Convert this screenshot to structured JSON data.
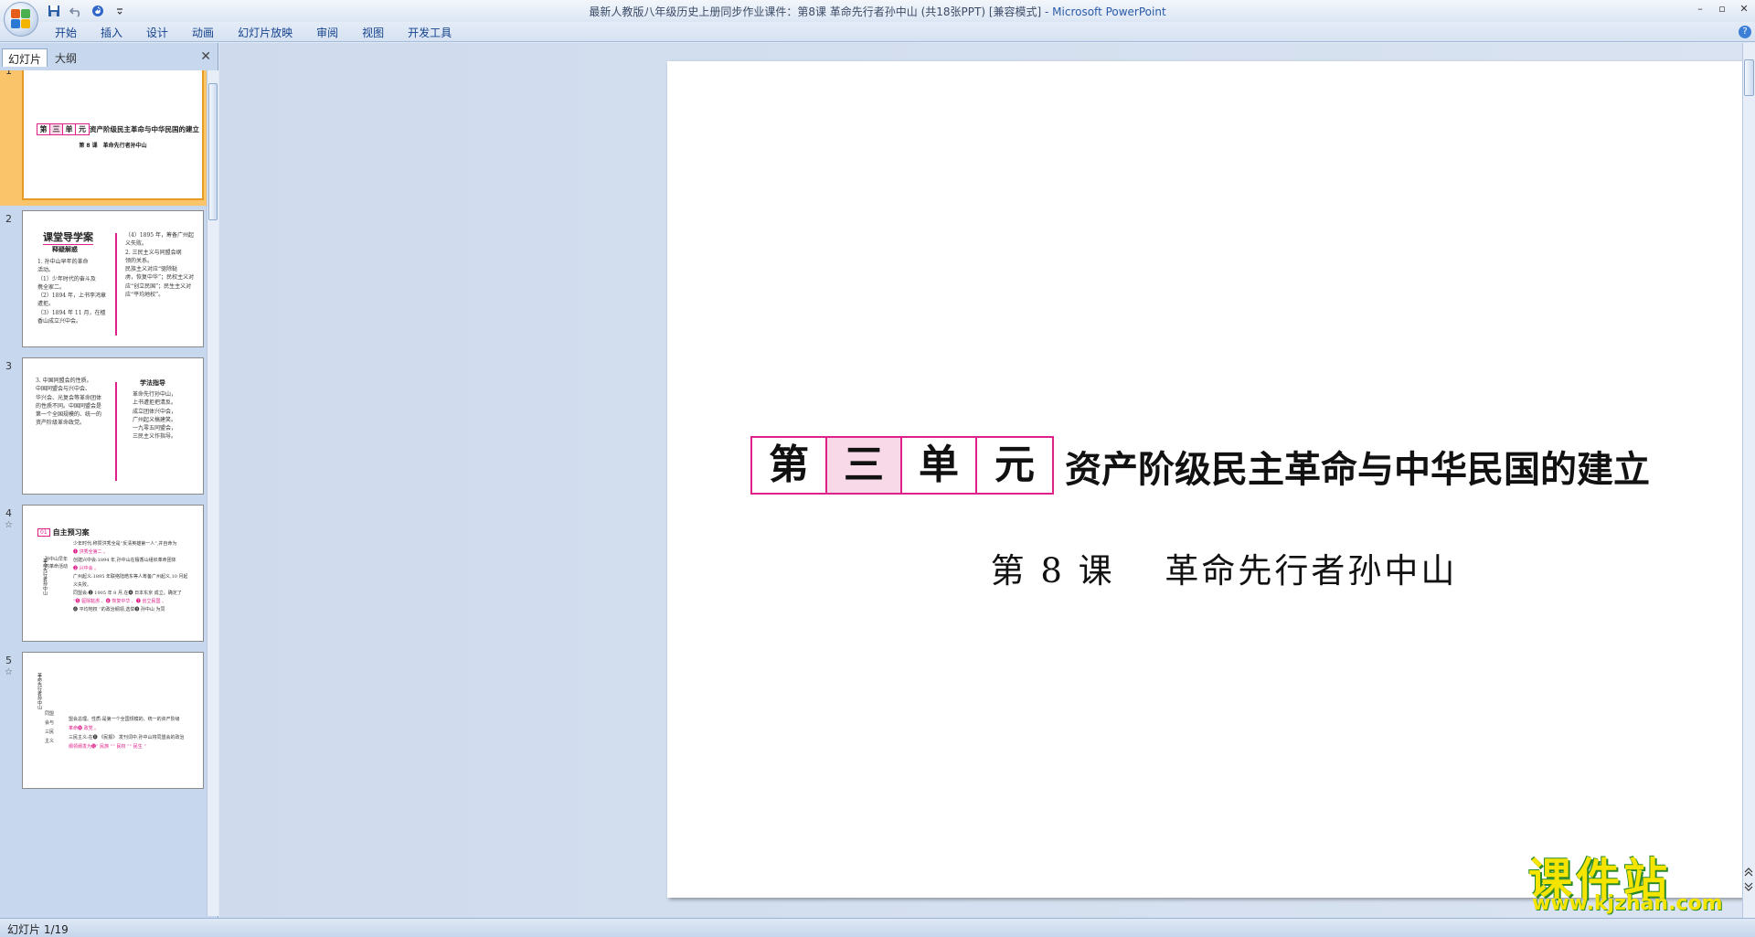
{
  "window": {
    "title": "最新人教版八年级历史上册同步作业课件：第8课 革命先行者孙中山 (共18张PPT) [兼容模式]",
    "app_name": " - Microsoft PowerPoint",
    "minimize": "–",
    "maximize": "▫",
    "close": "✕"
  },
  "ribbon": {
    "tabs": [
      "开始",
      "插入",
      "设计",
      "动画",
      "幻灯片放映",
      "审阅",
      "视图",
      "开发工具"
    ],
    "help": "?"
  },
  "left_pane": {
    "tab_slides": "幻灯片",
    "tab_outline": "大纲",
    "close": "✕",
    "thumbnails": [
      {
        "number": "1",
        "unit_chars": [
          "第",
          "三",
          "单",
          "元"
        ],
        "heading": "资产阶级民主革命与中华民国的建立",
        "subtitle": "第 8 课　革命先行者孙中山"
      },
      {
        "number": "2",
        "title": "课堂导学案",
        "subtitle": "释疑解惑",
        "left_lines": [
          "1. 孙中山早年的革命",
          "活动。",
          "（1）少年时代的奋斗及",
          "携全家二。",
          "（2）1894 年，上书李鸿章",
          "遭拒。",
          "（3）1894 年 11 月，在檀",
          "香山成立兴中会。"
        ],
        "right_lines": [
          "（4）1895 年，筹备广州起",
          "义失败。",
          "2. 三民主义与同盟会纲",
          "领的关系。",
          "民族主义对应“驱除鞑",
          "虏，恢复中华”；民权主义对",
          "应“创立民国”；民生主义对",
          "应“平均地权”。"
        ]
      },
      {
        "number": "3",
        "left_lines": [
          "3. 中国同盟会的性质。",
          "中国同盟会与兴中会、",
          "华兴会、光复会等革命团体",
          "的性质不同。中国同盟会是",
          "第一个全国规模的、统一的",
          "资产阶级革命政党。"
        ],
        "right_title": "学法指导",
        "right_lines": [
          "革命先行孙中山，",
          "上书遭拒把清反。",
          "成立团体兴中会，",
          "广州起义搞建笑。",
          "一九零五同盟会，",
          "三民主义作指导。"
        ]
      },
      {
        "number": "4",
        "star": "☆",
        "section_tag": "01",
        "section_title": "自主预习案",
        "lines": [
          "少年时代:称赞洪秀全是“反清英雄第一人”,并自命为",
          "❶ 洪秀全第二 。",
          "创建兴中会:1894 年,孙中山在檀香山组织革命团体",
          "❷ 兴中会 。",
          "广州起义:1895 年联络陆皓东等人筹备广州起义,10 月起",
          "义失败。",
          "同盟会:❸ 1905 年 8 月,在❹ 日本东京 成立。确定了",
          "“❺ 驱除鞑虏 、❻ 恢复中华 、❼ 创立民国 、",
          "❽ 平均地权 ”的政治纲领,选举❾ 孙中山 为同"
        ],
        "side_labels": [
          "孙中山早年",
          "的革命活动",
          "革命先行者孙中山"
        ]
      },
      {
        "number": "5",
        "star": "☆",
        "side_label": "革命先行者孙中山",
        "lines": [
          "盟会总理。性质:是第一个全国规模的、统一的资产阶级",
          "革命❿ 政党 。",
          "三民主义:在⓫ 《民报》 发刊词中,孙中山将同盟会的政治",
          "纲领阐发为⓬“ 民族 ”“ 民权 ”“ 民生 ”"
        ],
        "labels": [
          "同盟",
          "会与",
          "三民",
          "主义"
        ]
      }
    ]
  },
  "slide": {
    "unit_chars": [
      "第",
      "三",
      "单",
      "元"
    ],
    "heading": "资产阶级民主革命与中华民国的建立",
    "lesson": "第 8 课　 革命先行者孙中山"
  },
  "watermark": {
    "brand": "课件站",
    "url": "www.kjzhan.com"
  },
  "status": {
    "slide_counter": "幻灯片 1/19"
  },
  "colors": {
    "accent_pink": "#e0208a",
    "shaded_box": "#f7d9e7",
    "selected_thumb": "#f9c46a"
  }
}
